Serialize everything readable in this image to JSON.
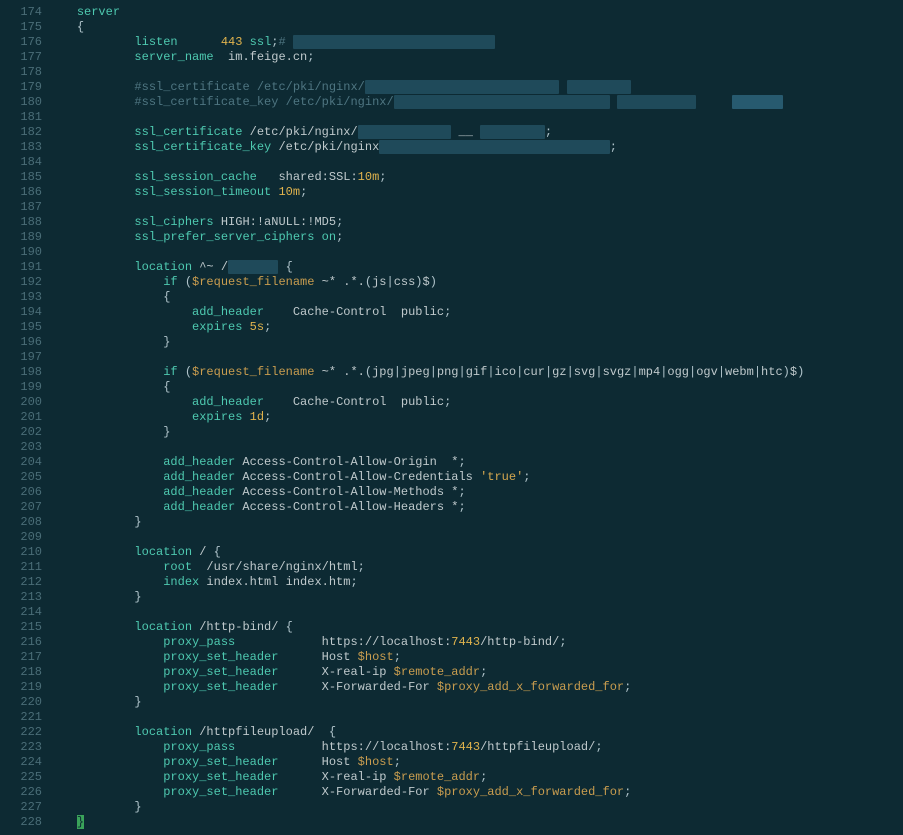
{
  "startLine": 174,
  "lines": [
    {
      "i": 0,
      "tokens": [
        [
          "kw",
          "server"
        ]
      ]
    },
    {
      "i": 0,
      "tokens": [
        [
          "op",
          "{"
        ]
      ]
    },
    {
      "i": 2,
      "tokens": [
        [
          "kw",
          "listen"
        ],
        [
          "",
          "      "
        ],
        [
          "num",
          "443"
        ],
        [
          "id",
          " "
        ],
        [
          "kw",
          "ssl"
        ],
        [
          "op",
          ";"
        ],
        [
          "cm",
          "# "
        ],
        [
          "hl",
          "                            "
        ]
      ]
    },
    {
      "i": 2,
      "tokens": [
        [
          "kw",
          "server_name"
        ],
        [
          "",
          "  "
        ],
        [
          "id",
          "im.feige.cn"
        ],
        [
          "op",
          ";"
        ]
      ]
    },
    {
      "i": 0,
      "tokens": []
    },
    {
      "i": 2,
      "tokens": [
        [
          "cm",
          "#ssl_certificate "
        ],
        [
          "cm",
          "/etc/pki/nginx/"
        ],
        [
          "hl",
          "                           "
        ],
        [
          "cm",
          " "
        ],
        [
          "hl",
          "         "
        ]
      ]
    },
    {
      "i": 2,
      "tokens": [
        [
          "cm",
          "#ssl_certificate_key "
        ],
        [
          "cm",
          "/etc/pki/nginx/"
        ],
        [
          "hl",
          "                              "
        ],
        [
          "cm",
          " "
        ],
        [
          "hl",
          "           "
        ],
        [
          "cm",
          "     "
        ],
        [
          "hl2",
          "       "
        ]
      ]
    },
    {
      "i": 0,
      "tokens": []
    },
    {
      "i": 2,
      "tokens": [
        [
          "kw",
          "ssl_certificate"
        ],
        [
          "id",
          " /etc/pki/nginx/"
        ],
        [
          "hl",
          "             "
        ],
        [
          "id",
          " __ "
        ],
        [
          "hl",
          "         "
        ],
        [
          "op",
          ";"
        ]
      ]
    },
    {
      "i": 2,
      "tokens": [
        [
          "kw",
          "ssl_certificate_key"
        ],
        [
          "id",
          " /etc/pki/nginx"
        ],
        [
          "hl",
          "                                "
        ],
        [
          "op",
          ";"
        ]
      ]
    },
    {
      "i": 0,
      "tokens": []
    },
    {
      "i": 2,
      "tokens": [
        [
          "kw",
          "ssl_session_cache"
        ],
        [
          "",
          "   "
        ],
        [
          "id",
          "shared:SSL:"
        ],
        [
          "num",
          "10m"
        ],
        [
          "op",
          ";"
        ]
      ]
    },
    {
      "i": 2,
      "tokens": [
        [
          "kw",
          "ssl_session_timeout"
        ],
        [
          "id",
          " "
        ],
        [
          "num",
          "10m"
        ],
        [
          "op",
          ";"
        ]
      ]
    },
    {
      "i": 0,
      "tokens": []
    },
    {
      "i": 2,
      "tokens": [
        [
          "kw",
          "ssl_ciphers"
        ],
        [
          "id",
          " HIGH:!aNULL:!MD5"
        ],
        [
          "op",
          ";"
        ]
      ]
    },
    {
      "i": 2,
      "tokens": [
        [
          "kw",
          "ssl_prefer_server_ciphers"
        ],
        [
          "id",
          " "
        ],
        [
          "kw",
          "on"
        ],
        [
          "op",
          ";"
        ]
      ]
    },
    {
      "i": 0,
      "tokens": []
    },
    {
      "i": 2,
      "tokens": [
        [
          "kw",
          "location"
        ],
        [
          "id",
          " ^~ /"
        ],
        [
          "hl",
          "       "
        ],
        [
          "id",
          " "
        ],
        [
          "op",
          "{"
        ]
      ]
    },
    {
      "i": 3,
      "tokens": [
        [
          "kw",
          "if"
        ],
        [
          "op",
          " ("
        ],
        [
          "var",
          "$request_filename"
        ],
        [
          "id",
          " ~* .*."
        ],
        [
          "op",
          "("
        ],
        [
          "id",
          "js"
        ],
        [
          "op",
          "|"
        ],
        [
          "id",
          "css"
        ],
        [
          "op",
          ")"
        ],
        [
          "id",
          "$"
        ],
        [
          "op",
          ")"
        ]
      ]
    },
    {
      "i": 3,
      "tokens": [
        [
          "op",
          "{"
        ]
      ]
    },
    {
      "i": 4,
      "tokens": [
        [
          "kw",
          "add_header"
        ],
        [
          "",
          "    "
        ],
        [
          "id",
          "Cache-Control  public"
        ],
        [
          "op",
          ";"
        ]
      ]
    },
    {
      "i": 4,
      "tokens": [
        [
          "kw",
          "expires"
        ],
        [
          "id",
          " "
        ],
        [
          "num",
          "5s"
        ],
        [
          "op",
          ";"
        ]
      ]
    },
    {
      "i": 3,
      "tokens": [
        [
          "op",
          "}"
        ]
      ]
    },
    {
      "i": 0,
      "tokens": []
    },
    {
      "i": 3,
      "tokens": [
        [
          "kw",
          "if"
        ],
        [
          "op",
          " ("
        ],
        [
          "var",
          "$request_filename"
        ],
        [
          "id",
          " ~* .*."
        ],
        [
          "op",
          "("
        ],
        [
          "id",
          "jpg"
        ],
        [
          "op",
          "|"
        ],
        [
          "id",
          "jpeg"
        ],
        [
          "op",
          "|"
        ],
        [
          "id",
          "png"
        ],
        [
          "op",
          "|"
        ],
        [
          "id",
          "gif"
        ],
        [
          "op",
          "|"
        ],
        [
          "id",
          "ico"
        ],
        [
          "op",
          "|"
        ],
        [
          "id",
          "cur"
        ],
        [
          "op",
          "|"
        ],
        [
          "id",
          "gz"
        ],
        [
          "op",
          "|"
        ],
        [
          "id",
          "svg"
        ],
        [
          "op",
          "|"
        ],
        [
          "id",
          "svgz"
        ],
        [
          "op",
          "|"
        ],
        [
          "id",
          "mp4"
        ],
        [
          "op",
          "|"
        ],
        [
          "id",
          "ogg"
        ],
        [
          "op",
          "|"
        ],
        [
          "id",
          "ogv"
        ],
        [
          "op",
          "|"
        ],
        [
          "id",
          "webm"
        ],
        [
          "op",
          "|"
        ],
        [
          "id",
          "htc"
        ],
        [
          "op",
          ")"
        ],
        [
          "id",
          "$"
        ],
        [
          "op",
          ")"
        ]
      ]
    },
    {
      "i": 3,
      "tokens": [
        [
          "op",
          "{"
        ]
      ]
    },
    {
      "i": 4,
      "tokens": [
        [
          "kw",
          "add_header"
        ],
        [
          "",
          "    "
        ],
        [
          "id",
          "Cache-Control  public"
        ],
        [
          "op",
          ";"
        ]
      ]
    },
    {
      "i": 4,
      "tokens": [
        [
          "kw",
          "expires"
        ],
        [
          "id",
          " "
        ],
        [
          "num",
          "1d"
        ],
        [
          "op",
          ";"
        ]
      ]
    },
    {
      "i": 3,
      "tokens": [
        [
          "op",
          "}"
        ]
      ]
    },
    {
      "i": 0,
      "tokens": []
    },
    {
      "i": 3,
      "tokens": [
        [
          "kw",
          "add_header"
        ],
        [
          "id",
          " Access-Control-Allow-Origin  *"
        ],
        [
          "op",
          ";"
        ]
      ]
    },
    {
      "i": 3,
      "tokens": [
        [
          "kw",
          "add_header"
        ],
        [
          "id",
          " Access-Control-Allow-Credentials "
        ],
        [
          "str",
          "'true'"
        ],
        [
          "op",
          ";"
        ]
      ]
    },
    {
      "i": 3,
      "tokens": [
        [
          "kw",
          "add_header"
        ],
        [
          "id",
          " Access-Control-Allow-Methods *"
        ],
        [
          "op",
          ";"
        ]
      ]
    },
    {
      "i": 3,
      "tokens": [
        [
          "kw",
          "add_header"
        ],
        [
          "id",
          " Access-Control-Allow-Headers *"
        ],
        [
          "op",
          ";"
        ]
      ]
    },
    {
      "i": 2,
      "tokens": [
        [
          "op",
          "}"
        ]
      ]
    },
    {
      "i": 0,
      "tokens": []
    },
    {
      "i": 2,
      "tokens": [
        [
          "kw",
          "location"
        ],
        [
          "id",
          " / "
        ],
        [
          "op",
          "{"
        ]
      ]
    },
    {
      "i": 3,
      "tokens": [
        [
          "kw",
          "root"
        ],
        [
          "id",
          "  /usr/share/nginx/html"
        ],
        [
          "op",
          ";"
        ]
      ]
    },
    {
      "i": 3,
      "tokens": [
        [
          "kw",
          "index"
        ],
        [
          "id",
          " index.html index.htm"
        ],
        [
          "op",
          ";"
        ]
      ]
    },
    {
      "i": 2,
      "tokens": [
        [
          "op",
          "}"
        ]
      ]
    },
    {
      "i": 0,
      "tokens": []
    },
    {
      "i": 2,
      "tokens": [
        [
          "kw",
          "location"
        ],
        [
          "id",
          " /http-bind/ "
        ],
        [
          "op",
          "{"
        ]
      ]
    },
    {
      "i": 3,
      "tokens": [
        [
          "kw",
          "proxy_pass"
        ],
        [
          "",
          "            "
        ],
        [
          "id",
          "https://localhost:"
        ],
        [
          "num",
          "7443"
        ],
        [
          "id",
          "/http-bind/"
        ],
        [
          "op",
          ";"
        ]
      ]
    },
    {
      "i": 3,
      "tokens": [
        [
          "kw",
          "proxy_set_header"
        ],
        [
          "",
          "      "
        ],
        [
          "id",
          "Host "
        ],
        [
          "var",
          "$host"
        ],
        [
          "op",
          ";"
        ]
      ]
    },
    {
      "i": 3,
      "tokens": [
        [
          "kw",
          "proxy_set_header"
        ],
        [
          "",
          "      "
        ],
        [
          "id",
          "X-real-ip "
        ],
        [
          "var",
          "$remote_addr"
        ],
        [
          "op",
          ";"
        ]
      ]
    },
    {
      "i": 3,
      "tokens": [
        [
          "kw",
          "proxy_set_header"
        ],
        [
          "",
          "      "
        ],
        [
          "id",
          "X-Forwarded-For "
        ],
        [
          "var",
          "$proxy_add_x_forwarded_for"
        ],
        [
          "op",
          ";"
        ]
      ]
    },
    {
      "i": 2,
      "tokens": [
        [
          "op",
          "}"
        ]
      ]
    },
    {
      "i": 0,
      "tokens": []
    },
    {
      "i": 2,
      "tokens": [
        [
          "kw",
          "location"
        ],
        [
          "id",
          " /httpfileupload/  "
        ],
        [
          "op",
          "{"
        ]
      ]
    },
    {
      "i": 3,
      "tokens": [
        [
          "kw",
          "proxy_pass"
        ],
        [
          "",
          "            "
        ],
        [
          "id",
          "https://localhost:"
        ],
        [
          "num",
          "7443"
        ],
        [
          "id",
          "/httpfileupload/"
        ],
        [
          "op",
          ";"
        ]
      ]
    },
    {
      "i": 3,
      "tokens": [
        [
          "kw",
          "proxy_set_header"
        ],
        [
          "",
          "      "
        ],
        [
          "id",
          "Host "
        ],
        [
          "var",
          "$host"
        ],
        [
          "op",
          ";"
        ]
      ]
    },
    {
      "i": 3,
      "tokens": [
        [
          "kw",
          "proxy_set_header"
        ],
        [
          "",
          "      "
        ],
        [
          "id",
          "X-real-ip "
        ],
        [
          "var",
          "$remote_addr"
        ],
        [
          "op",
          ";"
        ]
      ]
    },
    {
      "i": 3,
      "tokens": [
        [
          "kw",
          "proxy_set_header"
        ],
        [
          "",
          "      "
        ],
        [
          "id",
          "X-Forwarded-For "
        ],
        [
          "var",
          "$proxy_add_x_forwarded_for"
        ],
        [
          "op",
          ";"
        ]
      ]
    },
    {
      "i": 2,
      "tokens": [
        [
          "op",
          "}"
        ]
      ]
    },
    {
      "i": 0,
      "tokens": [
        [
          "cursor",
          "}"
        ]
      ]
    }
  ],
  "indentUnit": "    ",
  "baseIndent": "    "
}
